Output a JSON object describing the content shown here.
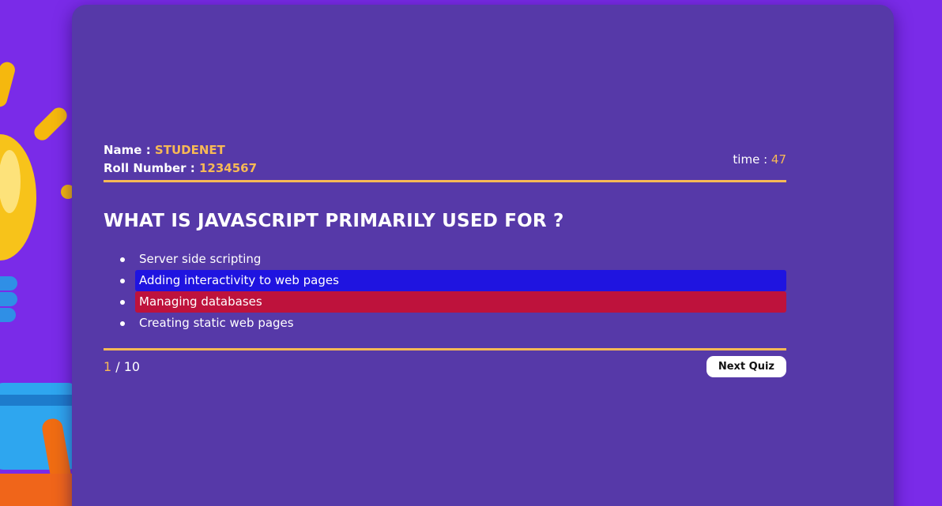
{
  "student": {
    "name_label": "Name : ",
    "name_value": "STUDENET",
    "roll_label": "Roll Number : ",
    "roll_value": "1234567"
  },
  "timer": {
    "label": "time : ",
    "value": "47"
  },
  "quiz": {
    "question": "WHAT IS JAVASCRIPT PRIMARILY USED FOR ?",
    "options": [
      {
        "text": "Server side scripting",
        "state": "default"
      },
      {
        "text": "Adding interactivity to web pages",
        "state": "correct",
        "highlight_color": "#1f14e0"
      },
      {
        "text": "Managing databases",
        "state": "wrong",
        "highlight_color": "#be123c"
      },
      {
        "text": "Creating static web pages",
        "state": "default"
      }
    ]
  },
  "progress": {
    "current": "1",
    "separator": " / ",
    "total": "10"
  },
  "next_button_label": "Next Quiz",
  "colors": {
    "page_background": "#7a2be8",
    "card_background": "#5639a8",
    "accent": "#f7b955"
  }
}
